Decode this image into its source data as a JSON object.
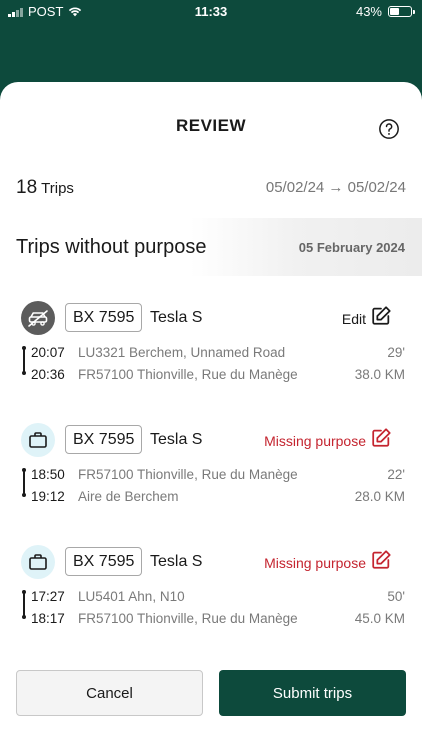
{
  "status_bar": {
    "carrier": "POST",
    "time": "11:33",
    "battery": "43%",
    "battery_level": 0.43
  },
  "sheet": {
    "title": "REVIEW",
    "trips_count": "18",
    "trips_label": "Trips",
    "date_range": "05/02/24 → 05/02/24"
  },
  "section": {
    "title": "Trips without purpose",
    "date": "05 February 2024"
  },
  "trips": [
    {
      "plate": "BX 7595",
      "car": "Tesla S",
      "status": "Edit",
      "start_time": "20:07",
      "start_address": "LU3321 Berchem, Unnamed Road",
      "duration": "29'",
      "end_time": "20:36",
      "end_address": "FR57100 Thionville, Rue du Manège",
      "distance": "38.0 KM"
    },
    {
      "plate": "BX 7595",
      "car": "Tesla S",
      "status": "Missing purpose",
      "start_time": "18:50",
      "start_address": "FR57100 Thionville, Rue du Manège",
      "duration": "22'",
      "end_time": "19:12",
      "end_address": "Aire de Berchem",
      "distance": "28.0 KM"
    },
    {
      "plate": "BX 7595",
      "car": "Tesla S",
      "status": "Missing purpose",
      "start_time": "17:27",
      "start_address": "LU5401 Ahn, N10",
      "duration": "50'",
      "end_time": "18:17",
      "end_address": "FR57100 Thionville, Rue du Manège",
      "distance": "45.0 KM"
    }
  ],
  "buttons": {
    "cancel": "Cancel",
    "submit": "Submit trips"
  },
  "colors": {
    "brand": "#0d4a3c",
    "missing": "#c4242f"
  },
  "icons": {
    "help": "help-circle-icon",
    "edit": "edit-icon",
    "car": "car-icon",
    "briefcase": "briefcase-icon"
  }
}
